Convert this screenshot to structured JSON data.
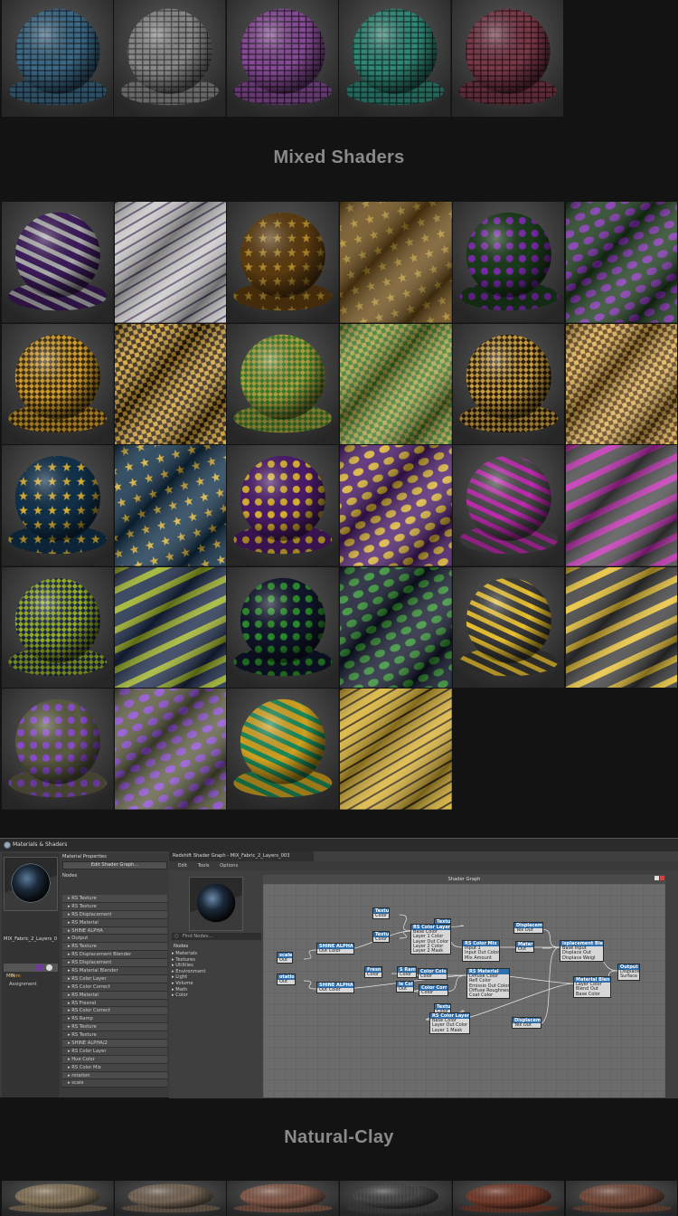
{
  "headings": {
    "mixed": "Mixed Shaders",
    "natural": "Natural-Clay"
  },
  "editor": {
    "window_title": "Materials & Shaders",
    "material_name": "MIX_Fabric_2_Layers_0",
    "mix_label": "MIX",
    "left_tabs": [
      "Mem",
      "Assignment"
    ],
    "material_properties_label": "Material Properties",
    "edit_shader_graph_button": "Edit Shader Graph...",
    "nodes_header": "Nodes",
    "node_list": [
      "RS Texture",
      "RS Texture",
      "RS Displacement",
      "RS Material",
      "SHINE ALPHA",
      "Output",
      "RS Texture",
      "RS Displacement Blender",
      "RS Displacement",
      "RS Material Blender",
      "RS Color Layer",
      "RS Color Correct",
      "RS Material",
      "RS Fresnel",
      "RS Color Correct",
      "RS Ramp",
      "RS Texture",
      "RS Texture",
      "SHINE ALPHA/2",
      "RS Color Layer",
      "Hue Color",
      "RS Color Mix",
      "rotation",
      "scale"
    ],
    "shader_graph_title": "Redshift Shader Graph - MIX_Fabric_2_Layers_003",
    "menu": [
      "Edit",
      "Tools",
      "Options"
    ],
    "graph_label": "Shader Graph",
    "find_nodes_placeholder": "Find Nodes...",
    "browser_header": "Nodes",
    "browser_items": [
      "Materials",
      "Textures",
      "Utilities",
      "Environment",
      "Light",
      "Volume",
      "Math",
      "Color"
    ],
    "graph_nodes": [
      {
        "title": "Textu",
        "ports": [
          "Color"
        ]
      },
      {
        "title": "Textu",
        "ports": [
          "Color"
        ]
      },
      {
        "title": "Textu",
        "ports": [
          "Color"
        ]
      },
      {
        "title": "RS Color Layer",
        "ports": [
          "Base Color",
          "Layer 1 Color",
          "Layer Out Color",
          "Layer 2 Color",
          "Layer 2 Mask"
        ]
      },
      {
        "title": "RS Color Mix",
        "ports": [
          "Input 1",
          "Input Out Color",
          "Mix Amount"
        ]
      },
      {
        "title": "Displacem",
        "ports": [
          "Tex Out"
        ]
      },
      {
        "title": "Mater",
        "ports": [
          "Out"
        ]
      },
      {
        "title": "isplacement Ble",
        "ports": [
          "Base Input",
          "Displace Out",
          "Displace Weigl"
        ]
      },
      {
        "title": "Output",
        "ports": [
          "Displace",
          "Surface"
        ]
      },
      {
        "title": "scale",
        "ports": [
          "Out"
        ]
      },
      {
        "title": "SHINE ALPHA",
        "ports": [
          "Out Color"
        ]
      },
      {
        "title": "otatio",
        "ports": [
          "Out"
        ]
      },
      {
        "title": "SHINE ALPHA",
        "ports": [
          "Out Color"
        ]
      },
      {
        "title": "Fresn",
        "ports": [
          "Color"
        ]
      },
      {
        "title": "le Col",
        "ports": [
          "Out"
        ]
      },
      {
        "title": "S Ram",
        "ports": [
          "Color"
        ]
      },
      {
        "title": "Color Colo",
        "ports": [
          "Color"
        ]
      },
      {
        "title": "Color Corr",
        "ports": [
          "Color"
        ]
      },
      {
        "title": "RS Material",
        "ports": [
          "Diffuse Color",
          "Refl Color",
          "Emissio Out Color",
          "Diffuse Roughnes",
          "Coat Color"
        ]
      },
      {
        "title": "Material Blen",
        "ports": [
          "Layer Color",
          "Blend Out",
          "Base Color"
        ]
      },
      {
        "title": "Textu",
        "ports": [
          "Color"
        ]
      },
      {
        "title": "Textu",
        "ports": [
          "Color"
        ]
      },
      {
        "title": "RS Color Layer",
        "ports": [
          "Base Color",
          "Layer Out Color",
          "Layer 1 Mask"
        ]
      },
      {
        "title": "Displacem",
        "ports": [
          "Tex Out"
        ]
      }
    ]
  },
  "colors": {
    "page_bg": "#131313",
    "heading": "#8a8a8a",
    "editor_bg": "#3c3c3c",
    "graph_bg": "#6b6b6b",
    "node_header": "#2f6fae"
  }
}
